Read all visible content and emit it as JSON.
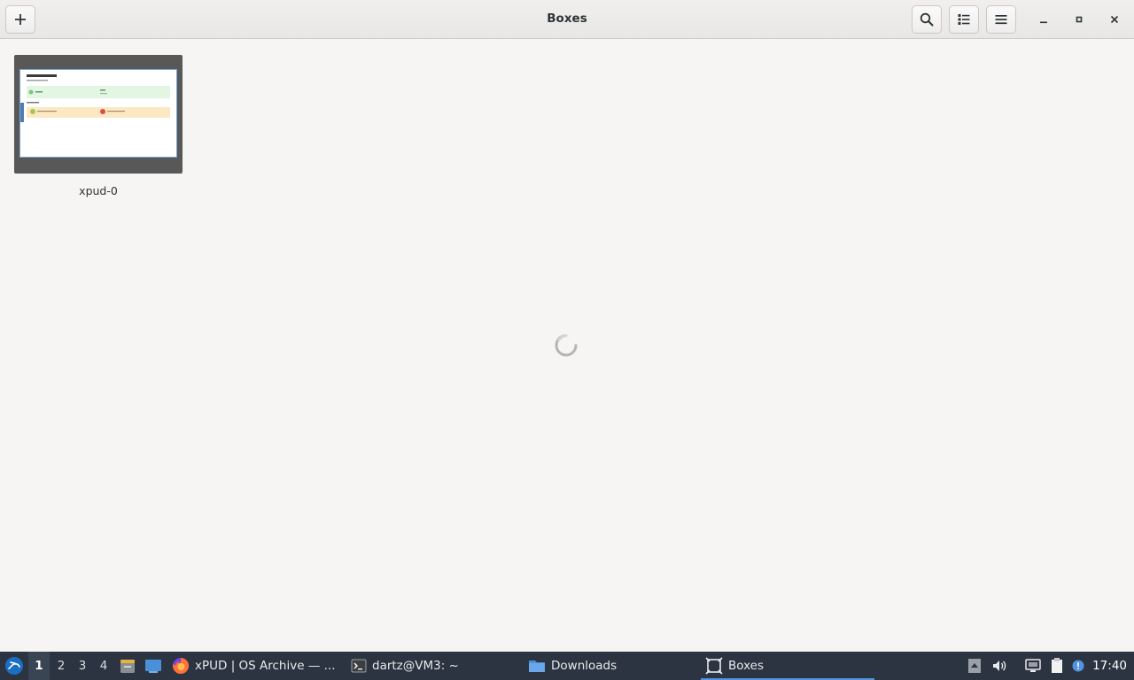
{
  "window": {
    "title": "Boxes"
  },
  "boxes": [
    {
      "name": "xpud-0"
    }
  ],
  "taskbar": {
    "workspaces": [
      "1",
      "2",
      "3",
      "4"
    ],
    "active_workspace": "1",
    "tasks": [
      {
        "label": "xPUD | OS Archive — ...",
        "icon": "firefox-icon"
      },
      {
        "label": "dartz@VM3: ~",
        "icon": "terminal-icon"
      },
      {
        "label": "Downloads",
        "icon": "folder-icon"
      },
      {
        "label": "Boxes",
        "icon": "boxes-icon",
        "active": true
      }
    ],
    "clock": "17:40"
  },
  "colors": {
    "accent": "#5294e2",
    "taskbar_bg": "#2b3440",
    "window_bg": "#f6f5f4"
  }
}
